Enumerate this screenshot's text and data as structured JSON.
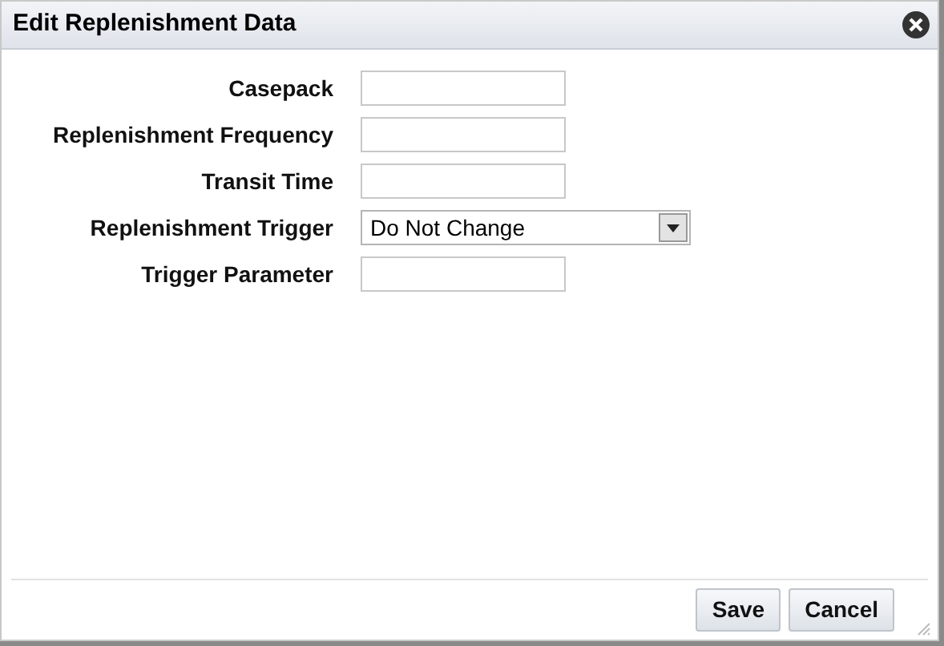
{
  "dialog": {
    "title": "Edit Replenishment Data"
  },
  "fields": [
    {
      "label": "Casepack",
      "kind": "text"
    },
    {
      "label": "Replenishment Frequency",
      "kind": "text"
    },
    {
      "label": "Transit Time",
      "kind": "text"
    },
    {
      "label": "Replenishment Trigger",
      "kind": "select",
      "value": "Do Not Change"
    },
    {
      "label": "Trigger Parameter",
      "kind": "text"
    }
  ],
  "buttons": [
    "Save",
    "Cancel"
  ]
}
